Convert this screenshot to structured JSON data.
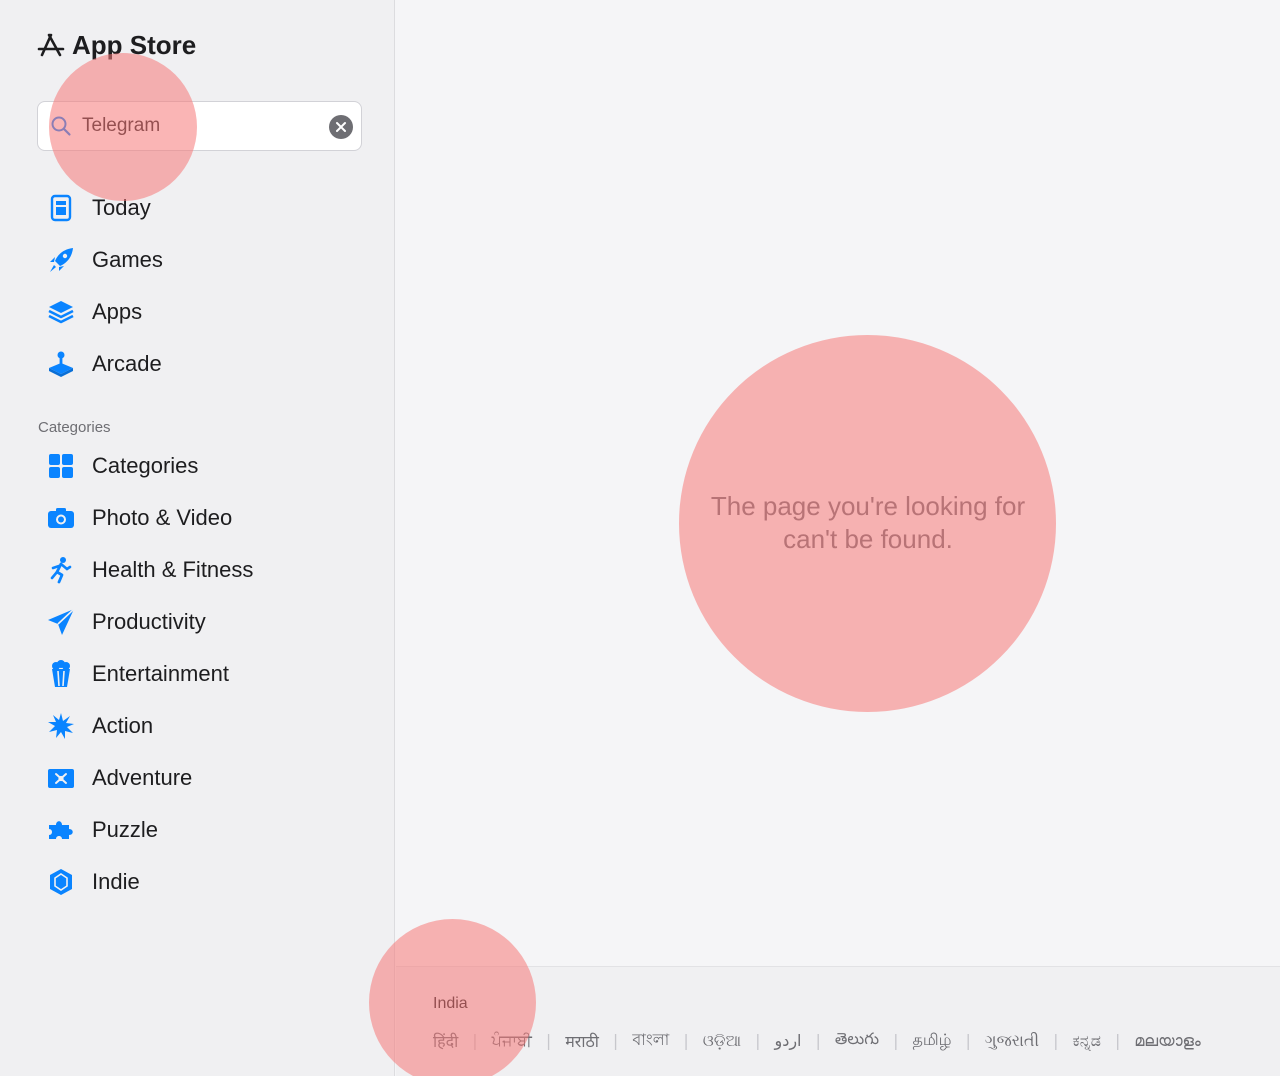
{
  "brand": {
    "title": "App Store"
  },
  "search": {
    "value": "Telegram",
    "placeholder": "Search"
  },
  "nav": [
    {
      "label": "Today",
      "icon": "today-icon"
    },
    {
      "label": "Games",
      "icon": "rocket-icon"
    },
    {
      "label": "Apps",
      "icon": "layers-icon"
    },
    {
      "label": "Arcade",
      "icon": "joystick-icon"
    }
  ],
  "categories": {
    "title": "Categories",
    "items": [
      {
        "label": "Categories",
        "icon": "grid-icon"
      },
      {
        "label": "Photo & Video",
        "icon": "camera-icon"
      },
      {
        "label": "Health & Fitness",
        "icon": "running-figure-icon"
      },
      {
        "label": "Productivity",
        "icon": "paper-plane-icon"
      },
      {
        "label": "Entertainment",
        "icon": "popcorn-icon"
      },
      {
        "label": "Action",
        "icon": "burst-icon"
      },
      {
        "label": "Adventure",
        "icon": "treasure-map-icon"
      },
      {
        "label": "Puzzle",
        "icon": "puzzle-piece-icon"
      },
      {
        "label": "Indie",
        "icon": "hexagon-gem-icon"
      }
    ]
  },
  "main": {
    "message": "The page you're looking for can't be found."
  },
  "footer": {
    "country": "India",
    "languages": [
      "हिंदी",
      "ਪੰਜਾਬੀ",
      "मराठी",
      "বাংলা",
      "ଓଡ଼ିଆ",
      "اردو",
      "తెలుగు",
      "தமிழ்",
      "ગુજરાતી",
      "ಕನ್ನಡ",
      "മലയാളം"
    ]
  },
  "colors": {
    "accent": "#0a84ff",
    "sidebar": "#f0f0f2",
    "background": "#f5f5f7"
  }
}
